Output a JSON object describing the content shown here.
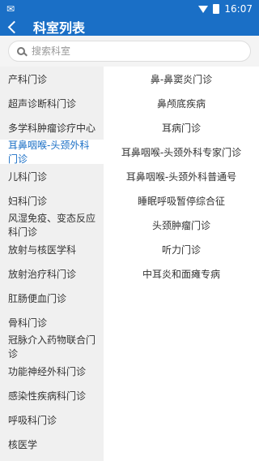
{
  "status": {
    "left_icon": "notification-icon",
    "time": "16:07"
  },
  "header": {
    "title": "科室列表"
  },
  "search": {
    "placeholder": "搜索科室"
  },
  "left_departments": [
    "产科门诊",
    "超声诊断科门诊",
    "多学科肿瘤诊疗中心",
    "耳鼻咽喉-头颈外科门诊",
    "儿科门诊",
    "妇科门诊",
    "风湿免疫、变态反应科门诊",
    "放射与核医学科",
    "放射治疗科门诊",
    "肛肠便血门诊",
    "骨科门诊",
    "冠脉介入药物联合门诊",
    "功能神经外科门诊",
    "感染性疾病科门诊",
    "呼吸科门诊",
    "核医学"
  ],
  "selected_index": 3,
  "right_departments": [
    "鼻-鼻窦炎门诊",
    "鼻颅底疾病",
    "耳病门诊",
    "耳鼻咽喉-头颈外科专家门诊",
    "耳鼻咽喉-头颈外科普通号",
    "睡眠呼吸暂停综合征",
    "头颈肿瘤门诊",
    "听力门诊",
    "中耳炎和面瘫专病"
  ],
  "colors": {
    "primary": "#1a6fc6",
    "selected_text": "#1a6fc6"
  }
}
